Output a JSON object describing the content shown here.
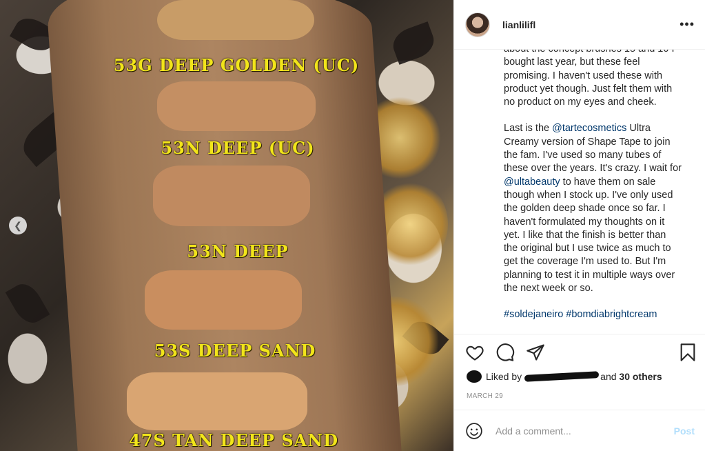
{
  "photo": {
    "labels": [
      "53G DEEP GOLDEN (UC)",
      "53N DEEP (UC)",
      "53N DEEP",
      "53S DEEP SAND",
      "47S TAN DEEP SAND"
    ],
    "label_color": "#f2e51a",
    "nav_icon": "chevron-left-icon"
  },
  "header": {
    "username": "lianlilifl",
    "more_icon": "more-options-icon"
  },
  "caption": {
    "para1": "about the concept brushes 15 and 10 I bought last year, but these feel promising. I haven't used these with product yet though. Just felt them with no product on my eyes and cheek.",
    "para2_a": "Last is the ",
    "mention1": "@tartecosmetics",
    "para2_b": " Ultra Creamy version of Shape Tape to join the fam. I've used so many tubes of these over the years. It's crazy. I wait for ",
    "mention2": "@ultabeauty",
    "para2_c": " to have them on sale though when I stock up. I've only used the golden deep shade once so far. I haven't formulated my thoughts on it yet. I like that the finish is better than the original but I use twice as much to get the coverage I'm used to. But I'm planning to test it in multiple ways over the next week or so.",
    "hashtags": "#soldejaneiro #bomdiabrightcream"
  },
  "actions": {
    "liked_by_prefix": "Liked by",
    "liked_by_suffix": "and",
    "others": "30 others",
    "date": "MARCH 29"
  },
  "comment": {
    "placeholder": "Add a comment...",
    "post_label": "Post"
  },
  "colors": {
    "link": "#00376b",
    "post_disabled": "#b2dffc",
    "muted": "#8e8e8e"
  }
}
